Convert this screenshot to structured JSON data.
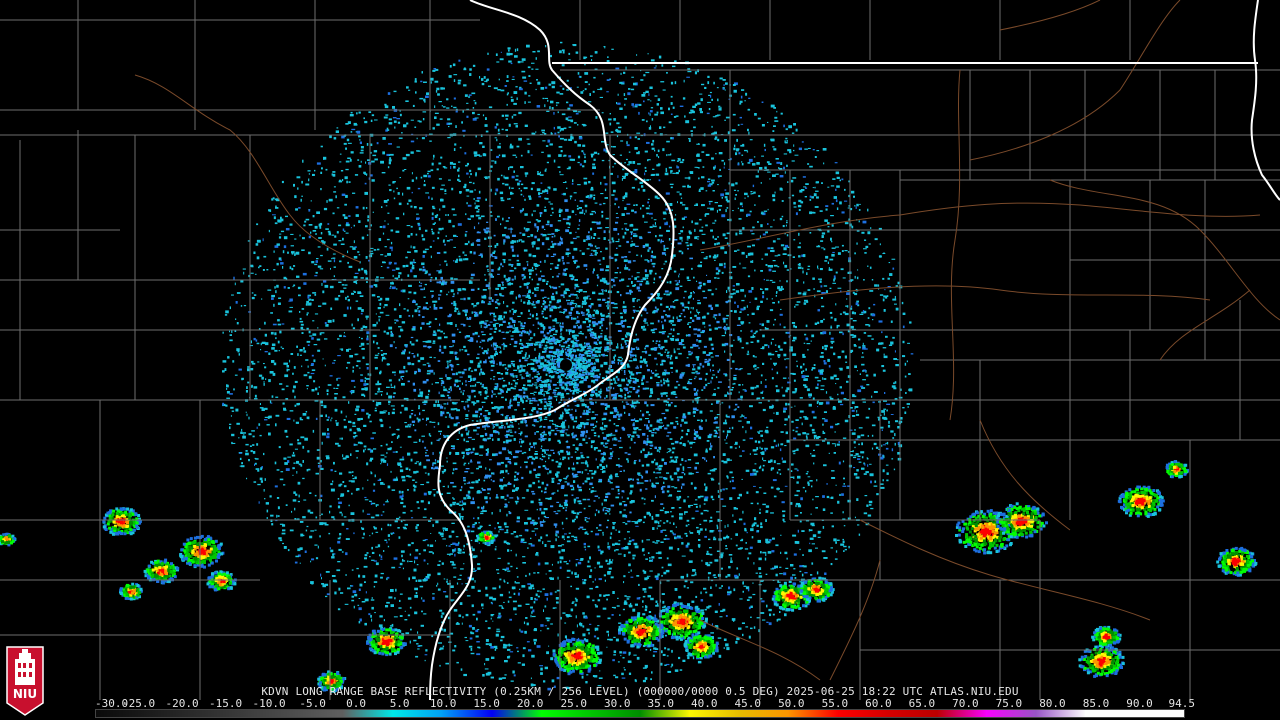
{
  "radar": {
    "caption": "KDVN LONG RANGE BASE REFLECTIVITY (0.25KM / 256 LEVEL) (000000/0000 0.5 DEG) 2025-06-25 18:22 UTC  ATLAS.NIU.EDU",
    "station": "KDVN",
    "product": "LONG RANGE BASE REFLECTIVITY",
    "timestamp": "2025-06-25 18:22 UTC",
    "source": "ATLAS.NIU.EDU"
  },
  "scale": {
    "labels": [
      "-30.0",
      "-25.0",
      "-20.0",
      "-15.0",
      "-10.0",
      "-5.0",
      "0.0",
      "5.0",
      "10.0",
      "15.0",
      "20.0",
      "25.0",
      "30.0",
      "35.0",
      "40.0",
      "45.0",
      "50.0",
      "55.0",
      "60.0",
      "65.0",
      "70.0",
      "75.0",
      "80.0",
      "85.0",
      "90.0",
      "94.5"
    ],
    "colors": [
      "#0a0a0a",
      "#1a1a1a",
      "#2b2b2b",
      "#3c3c3c",
      "#4d4d4d",
      "#606060",
      "#00e8e8",
      "#019ff4",
      "#0300f4",
      "#02fd02",
      "#01c501",
      "#008e00",
      "#fdf802",
      "#e5bc00",
      "#fd9500",
      "#fd0000",
      "#d40000",
      "#bc0000",
      "#f800fd",
      "#9854c6",
      "#fdfdfd",
      "#fdfdfd"
    ]
  },
  "logo": {
    "text": "NIU"
  }
}
